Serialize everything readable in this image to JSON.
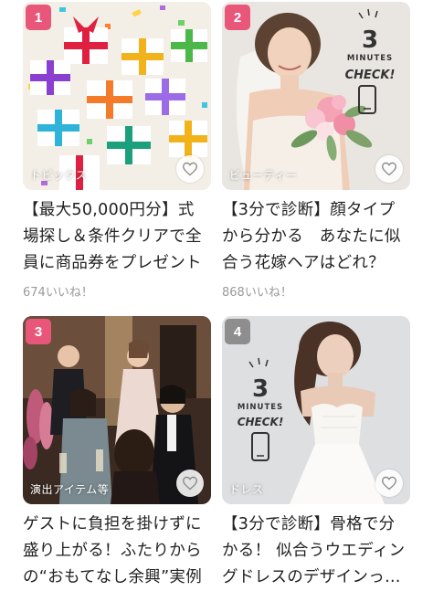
{
  "articles": [
    {
      "rank": "1",
      "rank_color": "#e8577a",
      "category": "トピックス",
      "title_lines": [
        "【最大50,000円分】式",
        "場探し＆条件クリアで全",
        "員に商品券をプレゼント"
      ],
      "likes": "674いいね！",
      "image_icon": "gift-boxes-image"
    },
    {
      "rank": "2",
      "rank_color": "#e8577a",
      "category": "ビューティー",
      "title_lines": [
        "【3分で診断】顔タイプ",
        "から分かる　あなたに似",
        "合う花嫁ヘアはどれ？"
      ],
      "likes": "868いいね！",
      "image_icon": "bride-bouquet-image",
      "badge": {
        "line1": "3",
        "line2": "MINUTES",
        "line3": "CHECK!"
      }
    },
    {
      "rank": "3",
      "rank_color": "#e8577a",
      "category": "演出アイテム等",
      "title_lines": [
        "ゲストに負担を掛けずに",
        "盛り上がる！ふたりから",
        "の“おもてなし余興”実例"
      ],
      "likes": "",
      "image_icon": "wedding-party-image"
    },
    {
      "rank": "4",
      "rank_color": "#8e8e8e",
      "category": "ドレス",
      "title_lines": [
        "【3分で診断】骨格で分",
        "かる！ 似合うウエディン",
        "グドレスのデザインっ…"
      ],
      "likes": "",
      "image_icon": "bride-dress-image",
      "badge": {
        "line1": "3",
        "line2": "MINUTES",
        "line3": "CHECK!"
      }
    }
  ]
}
